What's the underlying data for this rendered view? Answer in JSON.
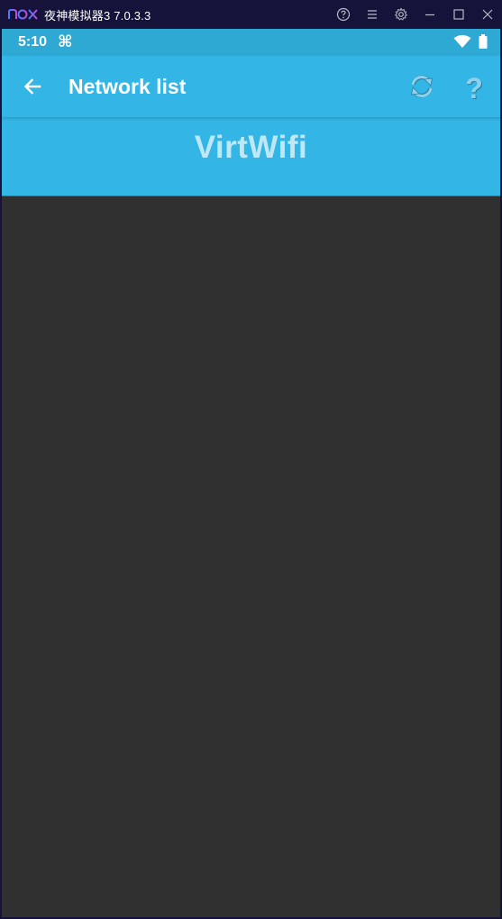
{
  "emulator": {
    "title": "夜神模拟器3 7.0.3.3",
    "logo_icon": "nox-logo",
    "controls": [
      "help-circle-icon",
      "menu-icon",
      "gear-icon",
      "minimize-icon",
      "maximize-icon",
      "close-icon"
    ]
  },
  "status_bar": {
    "time": "5:10",
    "command_glyph": "⌘",
    "icons": [
      "wifi-icon",
      "battery-icon"
    ]
  },
  "app_bar": {
    "title": "Network list",
    "back_icon": "arrow-back-icon",
    "refresh_icon": "refresh-icon",
    "help_glyph": "?"
  },
  "banner": {
    "text": "VirtWifi"
  },
  "colors": {
    "emulator_bg": "#15133a",
    "status_bar": "#2ea9d4",
    "app_bar": "#33b5e5",
    "banner_text": "#bfe8f7",
    "content_bg": "#303030"
  }
}
